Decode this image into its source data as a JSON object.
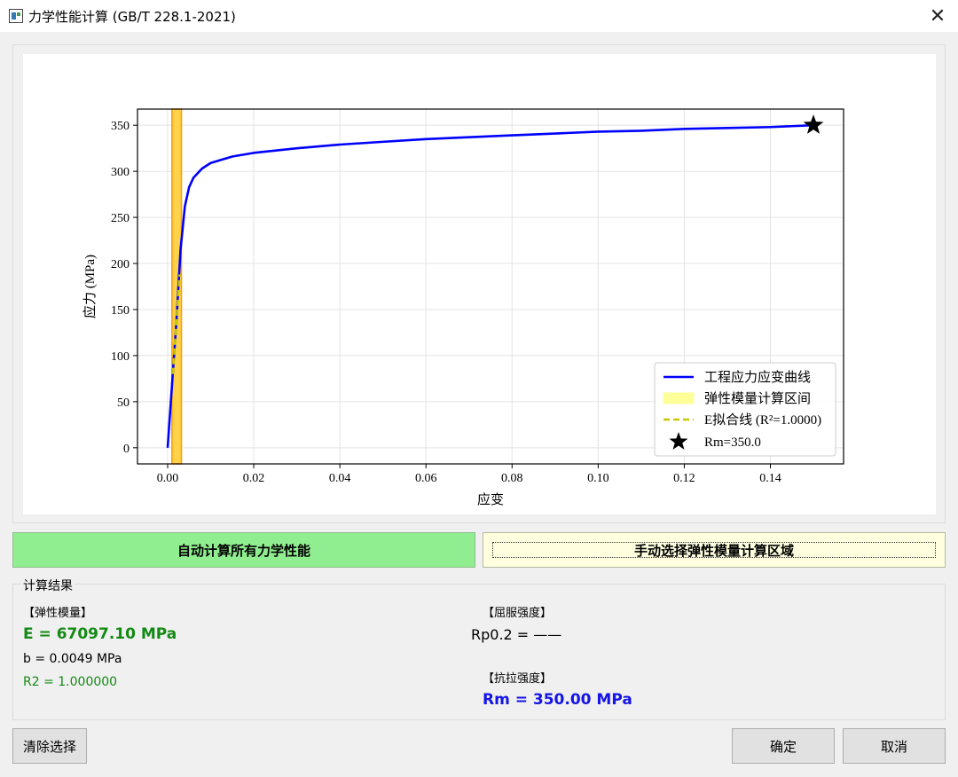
{
  "window": {
    "title": "力学性能计算 (GB/T 228.1-2021)",
    "close_glyph": "✕"
  },
  "chart_data": {
    "type": "line",
    "xlabel": "应变",
    "ylabel": "应力 (MPa)",
    "xlim": [
      -0.007,
      0.157
    ],
    "ylim": [
      -17.5,
      367.5
    ],
    "x_ticks": [
      "0.00",
      "0.02",
      "0.04",
      "0.06",
      "0.08",
      "0.10",
      "0.12",
      "0.14"
    ],
    "x_tick_values": [
      0,
      0.02,
      0.04,
      0.06,
      0.08,
      0.1,
      0.12,
      0.14
    ],
    "y_ticks": [
      "0",
      "50",
      "100",
      "150",
      "200",
      "250",
      "300",
      "350"
    ],
    "y_tick_values": [
      0,
      50,
      100,
      150,
      200,
      250,
      300,
      350
    ],
    "grid": true,
    "legend_position": "lower-right",
    "series": [
      {
        "name": "工程应力应变曲线",
        "color": "#0000ff",
        "x": [
          0,
          0.001,
          0.002,
          0.003,
          0.004,
          0.005,
          0.006,
          0.008,
          0.01,
          0.015,
          0.02,
          0.03,
          0.04,
          0.05,
          0.06,
          0.07,
          0.08,
          0.09,
          0.1,
          0.11,
          0.12,
          0.13,
          0.14,
          0.15
        ],
        "y": [
          0,
          67,
          134,
          215,
          262,
          283,
          293,
          303,
          309,
          316,
          320,
          325,
          329,
          332,
          335,
          337,
          339,
          341,
          343,
          344,
          346,
          347,
          348,
          350
        ]
      }
    ],
    "elastic_region": {
      "name": "弹性模量计算区间",
      "x_start": 0.001,
      "x_end": 0.0032,
      "color": "#ffd24a"
    },
    "fit_line": {
      "name": "E拟合线 (R²=1.0000)",
      "color": "#c8c800",
      "x": [
        0.0012,
        0.0028
      ],
      "y": [
        80,
        188
      ]
    },
    "rm_marker": {
      "name": "Rm=350.0",
      "x": 0.15,
      "y": 350,
      "color": "#000000"
    }
  },
  "buttons": {
    "auto_label": "自动计算所有力学性能",
    "manual_label": "手动选择弹性模量计算区域",
    "clear_label": "清除选择",
    "ok_label": "确定",
    "cancel_label": "取消"
  },
  "results": {
    "group_title": "计算结果",
    "elastic_header": "【弹性模量】",
    "e_value": "E = 67097.10 MPa",
    "b_value": "b = 0.0049 MPa",
    "r2_value": "R2 = 1.000000",
    "yield_header": "【屈服强度】",
    "rp_value": "Rp0.2 = ——",
    "tensile_header": "【抗拉强度】",
    "rm_value": "Rm = 350.00 MPa"
  }
}
